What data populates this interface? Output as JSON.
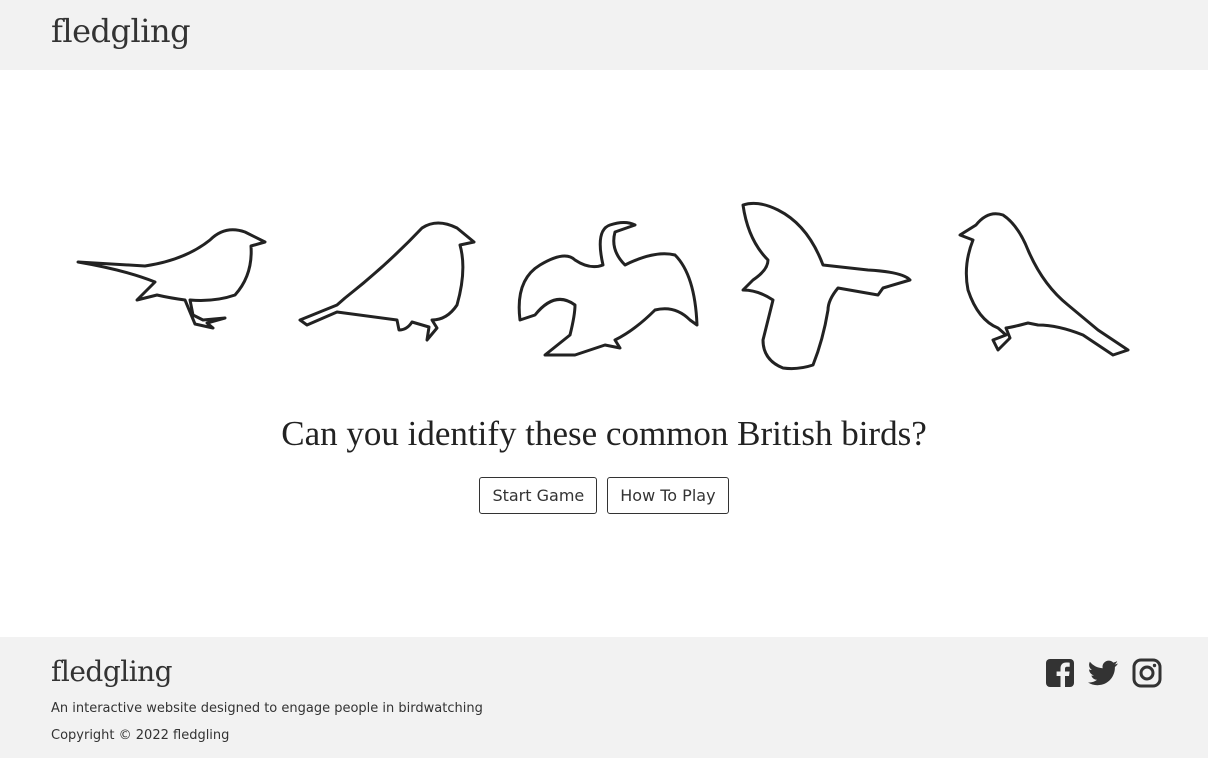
{
  "header": {
    "brand": "fledgling"
  },
  "hero": {
    "birds": [
      "robin-outline",
      "chaffinch-outline",
      "cormorant-outline",
      "magpie-outline",
      "sparrow-outline"
    ],
    "question": "Can you identify these common British birds?",
    "start_label": "Start Game",
    "howto_label": "How To Play"
  },
  "footer": {
    "brand": "fledgling",
    "description": "An interactive website designed to engage people in birdwatching",
    "copyright": "Copyright © 2022 fledgling",
    "social": [
      "facebook-icon",
      "twitter-icon",
      "instagram-icon"
    ]
  },
  "colors": {
    "band_bg": "#f2f2f2",
    "text": "#333333"
  }
}
